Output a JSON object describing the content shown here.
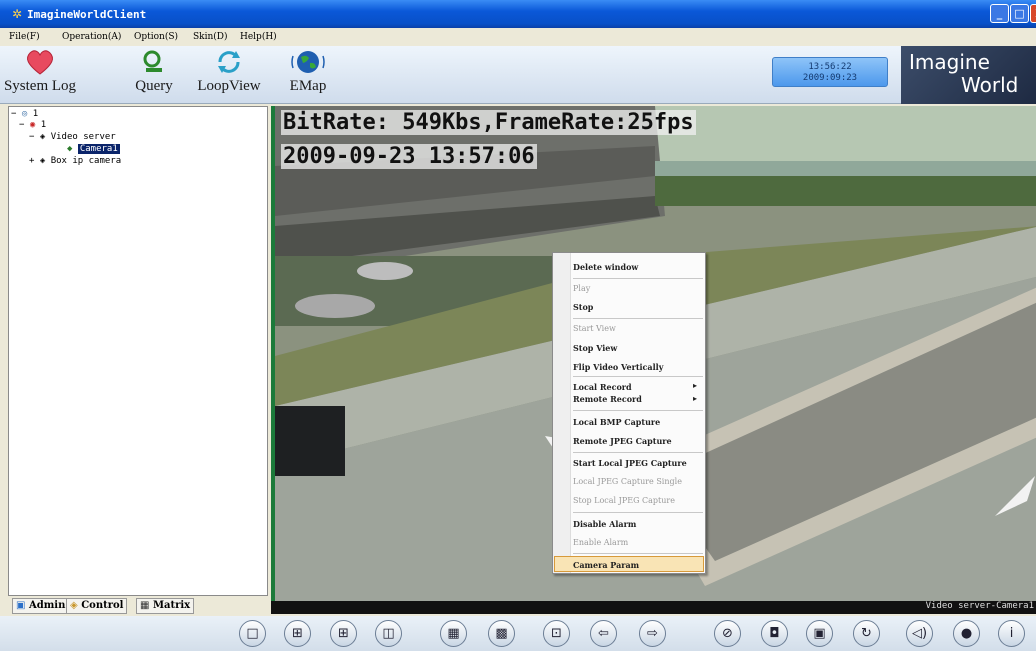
{
  "window": {
    "title": "ImagineWorldClient",
    "buttons": [
      "_",
      "□",
      "X"
    ]
  },
  "menu": [
    {
      "label": "File(F)"
    },
    {
      "label": "Operation(A)"
    },
    {
      "label": "Option(S)"
    },
    {
      "label": "Skin(D)"
    },
    {
      "label": "Help(H)"
    }
  ],
  "toolbar": {
    "items": [
      {
        "label": "System Log",
        "icon": "heart-icon"
      },
      {
        "label": "Query",
        "icon": "query-icon"
      },
      {
        "label": "LoopView",
        "icon": "loop-arrows-icon"
      },
      {
        "label": "EMap",
        "icon": "globe-icon"
      }
    ]
  },
  "clock": {
    "time": "13:56:22",
    "date": "2009:09:23"
  },
  "brand": {
    "line1": "Imagine",
    "line2": "World"
  },
  "tree": {
    "root": "1",
    "group": "1",
    "server": "Video server",
    "camera": "Camera1",
    "box": "Box ip camera",
    "expand": "−",
    "collapse": "+"
  },
  "tabs": [
    {
      "label": "Admin",
      "icon": "admin-icon"
    },
    {
      "label": "Control",
      "icon": "control-icon"
    },
    {
      "label": "Matrix",
      "icon": "matrix-icon"
    }
  ],
  "video": {
    "osd_bitrate": "BitRate: 549Kbs,FrameRate:25fps",
    "osd_time": "2009-09-23 13:57:06",
    "status": "Video server-Camera1"
  },
  "context_menu": {
    "items": [
      {
        "label": "Delete window",
        "enabled": true
      },
      {
        "label": "Play",
        "enabled": false
      },
      {
        "label": "Stop",
        "enabled": true
      },
      {
        "label": "Start View",
        "enabled": false
      },
      {
        "label": "Stop View",
        "enabled": true
      },
      {
        "label": "Flip Video Vertically",
        "enabled": true
      },
      {
        "label": "Local Record",
        "enabled": true,
        "submenu": true
      },
      {
        "label": "Remote Record",
        "enabled": true,
        "submenu": true
      },
      {
        "label": "Local BMP Capture",
        "enabled": true
      },
      {
        "label": "Remote JPEG Capture",
        "enabled": true
      },
      {
        "label": "Start Local JPEG Capture",
        "enabled": true
      },
      {
        "label": "Local JPEG Capture Single",
        "enabled": false
      },
      {
        "label": "Stop Local JPEG Capture",
        "enabled": false
      },
      {
        "label": "Disable Alarm",
        "enabled": true
      },
      {
        "label": "Enable Alarm",
        "enabled": false
      },
      {
        "label": "Camera Param",
        "enabled": true,
        "highlighted": true
      }
    ],
    "submenu_arrow": "▸"
  },
  "controls": [
    {
      "name": "layout-1-icon",
      "glyph": "□"
    },
    {
      "name": "layout-4-icon",
      "glyph": "⊞"
    },
    {
      "name": "layout-6-icon",
      "glyph": "⊞"
    },
    {
      "name": "layout-8-icon",
      "glyph": "◫"
    },
    {
      "name": "layout-9-icon",
      "glyph": "▦"
    },
    {
      "name": "layout-16-icon",
      "glyph": "▩"
    },
    {
      "name": "fullscreen-icon",
      "glyph": "⊡"
    },
    {
      "name": "prev-icon",
      "glyph": "⇦"
    },
    {
      "name": "next-icon",
      "glyph": "⇨"
    },
    {
      "name": "mute-icon",
      "glyph": "⊘"
    },
    {
      "name": "camera-icon",
      "glyph": "◘"
    },
    {
      "name": "record-icon",
      "glyph": "▣"
    },
    {
      "name": "ptz-icon",
      "glyph": "↻"
    },
    {
      "name": "volume-icon",
      "glyph": "◁)"
    },
    {
      "name": "talk-icon",
      "glyph": "●"
    },
    {
      "name": "info-icon",
      "glyph": "i"
    }
  ]
}
